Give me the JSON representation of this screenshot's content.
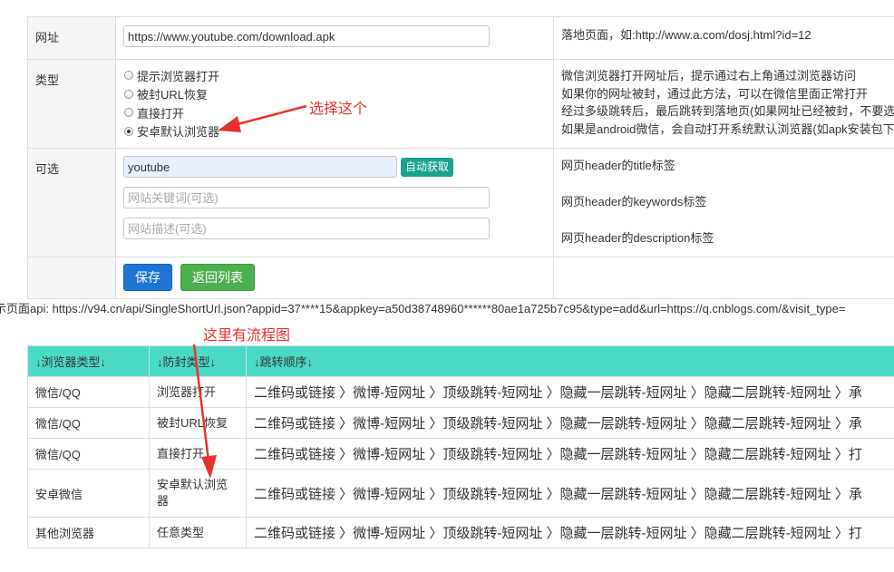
{
  "form": {
    "url": {
      "label": "网址",
      "value": "https://www.youtube.com/download.apk",
      "desc": "落地页面，如:http://www.a.com/dosj.html?id=12"
    },
    "type": {
      "label": "类型",
      "options": [
        "提示浏览器打开",
        "被封URL恢复",
        "直接打开",
        "安卓默认浏览器"
      ],
      "selected": "安卓默认浏览器",
      "desc": [
        "微信浏览器打开网址后，提示通过右上角通过浏览器访问",
        "如果你的网址被封，通过此方法，可以在微信里面正常打开",
        "经过多级跳转后，最后跳转到落地页(如果网址已经被封，不要选择",
        "如果是android微信，会自动打开系统默认浏览器(如apk安装包下载"
      ]
    },
    "optional": {
      "label": "可选",
      "title_value": "youtube",
      "auto_button": "自动获取",
      "keywords_placeholder": "网站关键词(可选)",
      "description_placeholder": "网站描述(可选)",
      "desc_title": "网页header的title标签",
      "desc_keywords": "网页header的keywords标签",
      "desc_description": "网页header的description标签"
    },
    "buttons": {
      "save": "保存",
      "back": "返回列表"
    }
  },
  "api_line": "示页面api: https://v94.cn/api/SingleShortUrl.json?appid=37****15&appkey=a50d38748960******80ae1a725b7c95&type=add&url=https://q.cnblogs.com/&visit_type=",
  "flow_table": {
    "headers": [
      "↓浏览器类型↓",
      "↓防封类型↓",
      "↓跳转顺序↓"
    ],
    "rows": [
      {
        "browser": "微信/QQ",
        "type": "浏览器打开",
        "flow": "二维码或链接 〉微博-短网址 〉顶级跳转-短网址 〉隐藏一层跳转-短网址 〉隐藏二层跳转-短网址 〉承"
      },
      {
        "browser": "微信/QQ",
        "type": "被封URL恢复",
        "flow": "二维码或链接 〉微博-短网址 〉顶级跳转-短网址 〉隐藏一层跳转-短网址 〉隐藏二层跳转-短网址 〉承"
      },
      {
        "browser": "微信/QQ",
        "type": "直接打开",
        "flow": "二维码或链接 〉微博-短网址 〉顶级跳转-短网址 〉隐藏一层跳转-短网址 〉隐藏二层跳转-短网址 〉打"
      },
      {
        "browser": "安卓微信",
        "type": "安卓默认浏览器",
        "flow": "二维码或链接 〉微博-短网址 〉顶级跳转-短网址 〉隐藏一层跳转-短网址 〉隐藏二层跳转-短网址 〉承"
      },
      {
        "browser": "其他浏览器",
        "type": "任意类型",
        "flow": "二维码或链接 〉微博-短网址 〉顶级跳转-短网址 〉隐藏一层跳转-短网址 〉隐藏二层跳转-短网址 〉打"
      }
    ]
  },
  "annotations": {
    "select_this": "选择这个",
    "flowchart_here": "这里有流程图",
    "color": "#e8322e"
  },
  "colors": {
    "header_teal": "#4bdac6",
    "save_blue": "#1f76d2",
    "back_green": "#4cb04f",
    "auto_teal": "#1aa18e"
  }
}
